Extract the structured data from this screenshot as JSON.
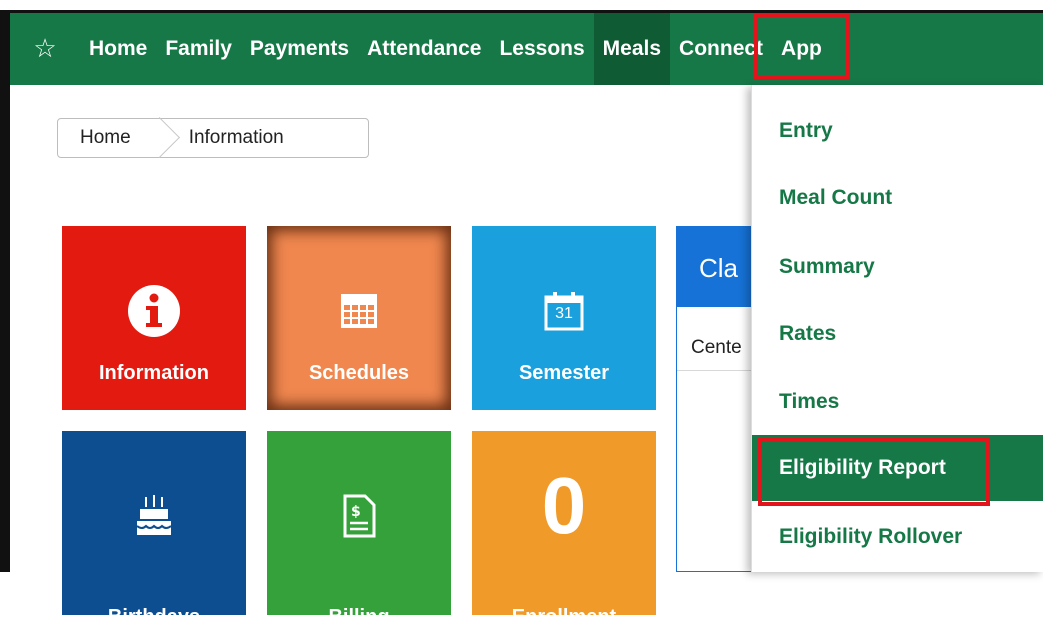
{
  "nav": {
    "items": [
      "Home",
      "Family",
      "Payments",
      "Attendance",
      "Lessons",
      "Meals",
      "Connect",
      "App"
    ],
    "active": "Meals"
  },
  "breadcrumb": [
    "Home",
    "Information"
  ],
  "tiles": {
    "information": "Information",
    "schedules": "Schedules",
    "semester": "Semester",
    "semester_icon_day": "31",
    "birthdays": "Birthdays",
    "billing": "Billing",
    "count_value": "0",
    "count_label": "Enrollment"
  },
  "panel": {
    "title": "Cla",
    "row": "Cente"
  },
  "meals_menu": {
    "items": [
      "Entry",
      "Meal Count",
      "Summary",
      "Rates",
      "Times",
      "Eligibility Report",
      "Eligibility Rollover"
    ],
    "active": "Eligibility Report"
  },
  "colors": {
    "nav_bg": "#167847",
    "highlight": "#e4141d",
    "info_tile": "#e21a10",
    "schedules_tile": "#f0874f",
    "semester_tile": "#1aa0dd",
    "birthday_tile": "#0c4e90",
    "billing_tile": "#35a13a",
    "count_tile": "#f09a2a",
    "panel_blue": "#1672d6"
  }
}
